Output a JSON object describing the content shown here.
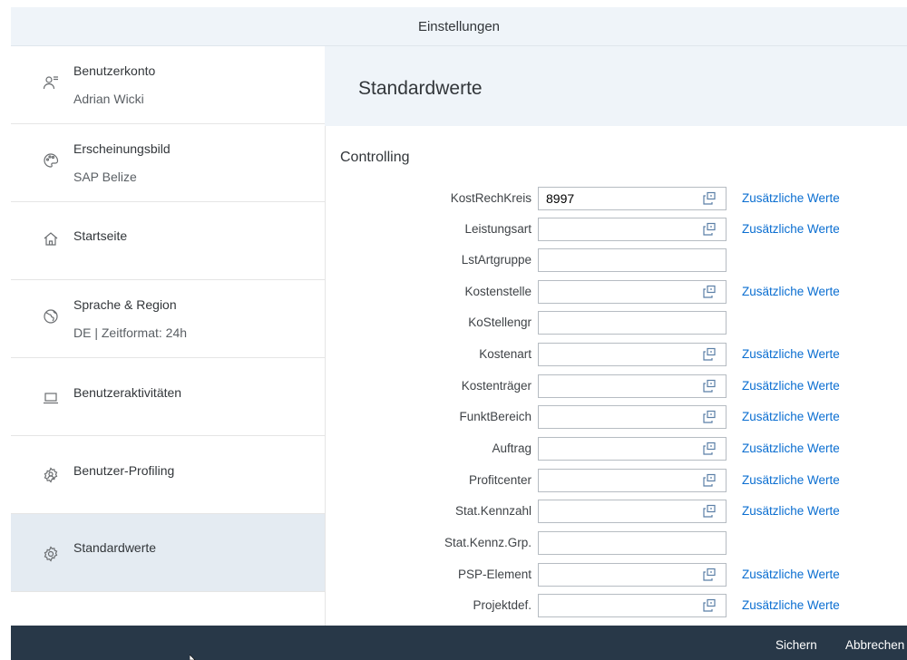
{
  "header": {
    "title": "Einstellungen"
  },
  "sidebar": {
    "items": [
      {
        "title": "Benutzerkonto",
        "subtitle": "Adrian Wicki",
        "icon": "user-account-icon"
      },
      {
        "title": "Erscheinungsbild",
        "subtitle": "SAP Belize",
        "icon": "palette-icon"
      },
      {
        "title": "Startseite",
        "subtitle": "",
        "icon": "home-icon"
      },
      {
        "title": "Sprache & Region",
        "subtitle": "DE | Zeitformat: 24h",
        "icon": "globe-icon"
      },
      {
        "title": "Benutzeraktivitäten",
        "subtitle": "",
        "icon": "laptop-icon"
      },
      {
        "title": "Benutzer-Profiling",
        "subtitle": "",
        "icon": "user-settings-icon"
      },
      {
        "title": "Standardwerte",
        "subtitle": "",
        "icon": "gear-icon",
        "selected": true
      }
    ]
  },
  "content": {
    "title": "Standardwerte",
    "section": "Controlling",
    "more_label": "Zusätzliche Werte",
    "fields": [
      {
        "label": "KostRechKreis",
        "value": "8997",
        "value_help": true,
        "more": true
      },
      {
        "label": "Leistungsart",
        "value": "",
        "value_help": true,
        "more": true
      },
      {
        "label": "LstArtgruppe",
        "value": "",
        "value_help": false,
        "more": false
      },
      {
        "label": "Kostenstelle",
        "value": "",
        "value_help": true,
        "more": true
      },
      {
        "label": "KoStellengr",
        "value": "",
        "value_help": false,
        "more": false
      },
      {
        "label": "Kostenart",
        "value": "",
        "value_help": true,
        "more": true
      },
      {
        "label": "Kostenträger",
        "value": "",
        "value_help": true,
        "more": true
      },
      {
        "label": "FunktBereich",
        "value": "",
        "value_help": true,
        "more": true
      },
      {
        "label": "Auftrag",
        "value": "",
        "value_help": true,
        "more": true
      },
      {
        "label": "Profitcenter",
        "value": "",
        "value_help": true,
        "more": true
      },
      {
        "label": "Stat.Kennzahl",
        "value": "",
        "value_help": true,
        "more": true
      },
      {
        "label": "Stat.Kennz.Grp.",
        "value": "",
        "value_help": false,
        "more": false
      },
      {
        "label": "PSP-Element",
        "value": "",
        "value_help": true,
        "more": true
      },
      {
        "label": "Projektdef.",
        "value": "",
        "value_help": true,
        "more": true
      }
    ]
  },
  "footer": {
    "save_label": "Sichern",
    "cancel_label": "Abbrechen"
  },
  "colors": {
    "link": "#0a6ed1",
    "footer_bg": "#283848",
    "header_bg": "#eff4f9",
    "selected_bg": "#e4ebf2"
  }
}
